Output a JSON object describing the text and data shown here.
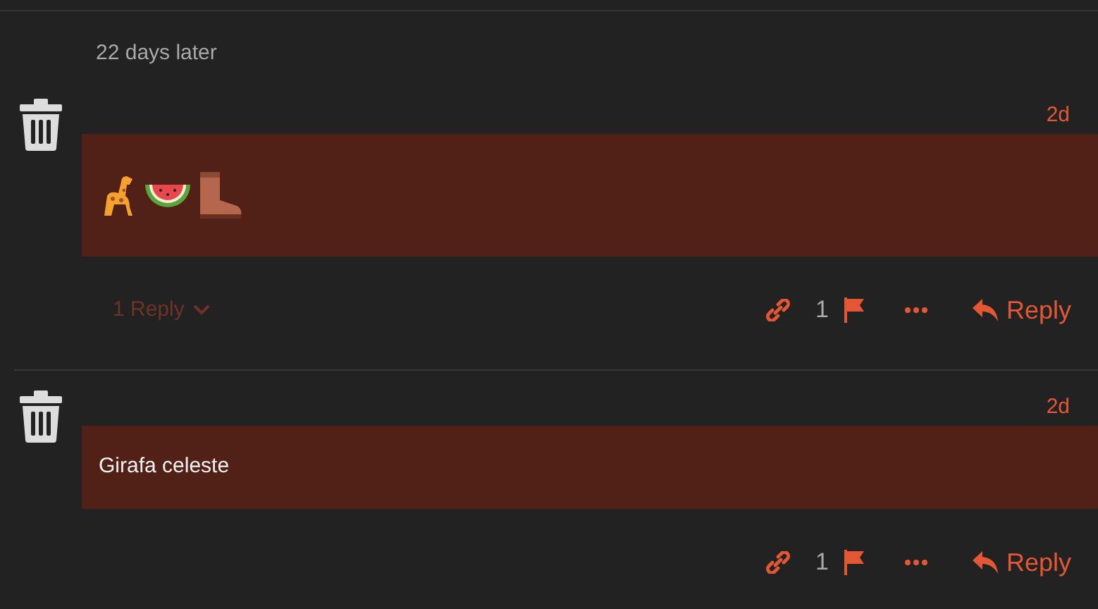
{
  "gap_notice": "22 days later",
  "posts": [
    {
      "deleted": true,
      "time": "2d",
      "content": {
        "kind": "emoji"
      },
      "replies": "1 Reply",
      "flag_count": "1",
      "reply_label": "Reply"
    },
    {
      "deleted": true,
      "time": "2d",
      "content": {
        "kind": "text",
        "text": "Girafa celeste"
      },
      "flag_count": "1",
      "reply_label": "Reply"
    }
  ]
}
